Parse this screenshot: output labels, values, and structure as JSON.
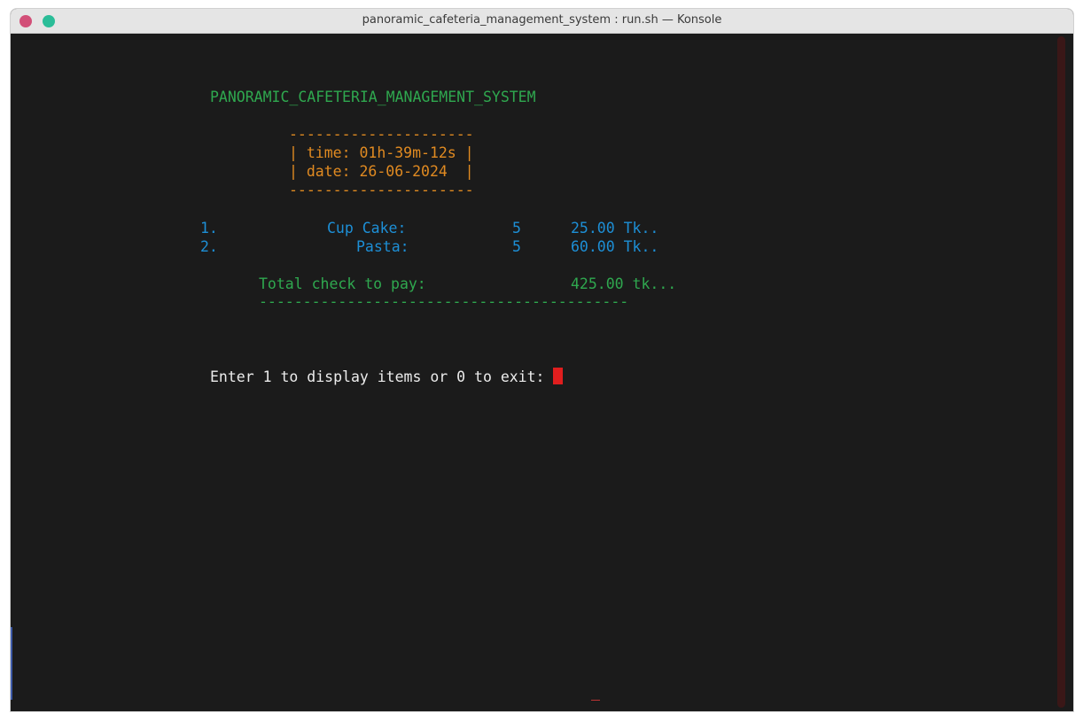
{
  "window": {
    "title": "panoramic_cafeteria_management_system : run.sh — Konsole"
  },
  "terminal": {
    "header": "PANORAMIC_CAFETERIA_MANAGEMENT_SYSTEM",
    "box_border": "---------------------",
    "time_line": "| time: 01h-39m-12s |",
    "date_line": "| date: 26-06-2024  |",
    "items": [
      {
        "index": "1.",
        "name": "Cup Cake:",
        "qty": "5",
        "price": "25.00 Tk.."
      },
      {
        "index": "2.",
        "name": "Pasta:",
        "qty": "5",
        "price": "60.00 Tk.."
      }
    ],
    "total_label": "Total check to pay:",
    "total_value": "425.00 tk...",
    "separator": "------------------------------------------",
    "prompt": "Enter 1 to display items or 0 to exit: "
  },
  "colors": {
    "header": "#2fa84f",
    "box": "#e08a21",
    "items": "#1d8fd6",
    "prompt": "#ececec",
    "cursor": "#e01e1e",
    "background": "#1b1b1b"
  }
}
